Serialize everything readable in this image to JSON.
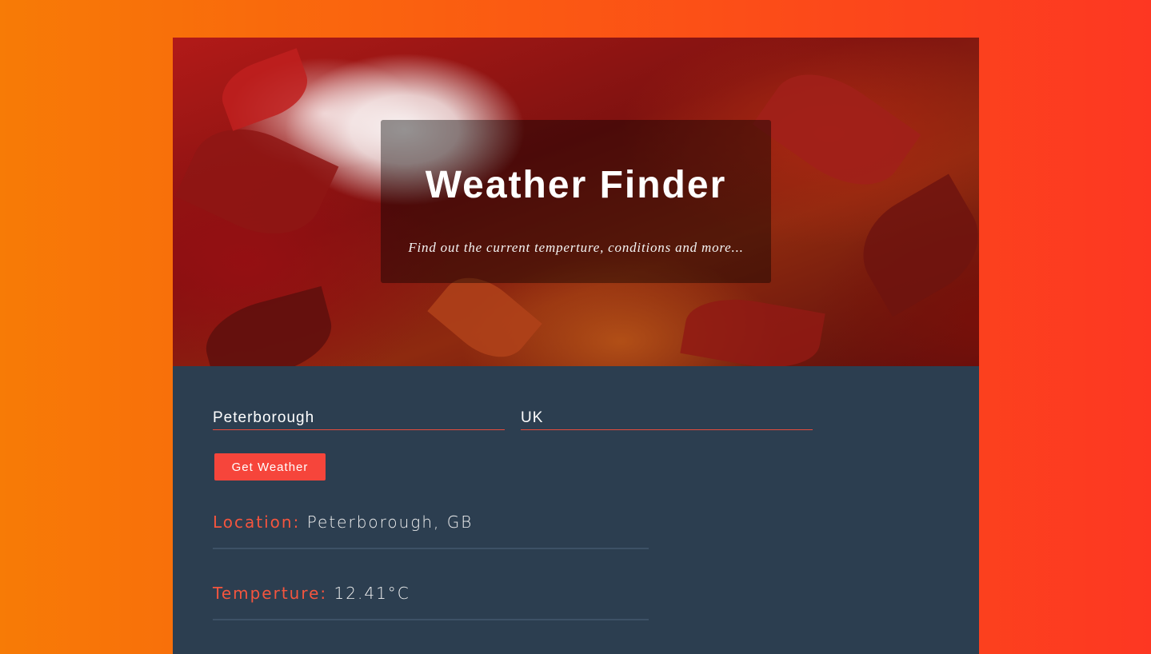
{
  "hero": {
    "title": "Weather Finder",
    "subtitle": "Find out the current temperture, conditions and more..."
  },
  "form": {
    "city_value": "Peterborough",
    "country_value": "UK",
    "button_label": "Get Weather"
  },
  "results": {
    "location_label": "Location:",
    "location_value": "Peterborough, GB",
    "temperature_label": "Temperture:",
    "temperature_value": "12.41°C"
  },
  "colors": {
    "accent": "#f6453b",
    "panel": "#2c3e50"
  }
}
